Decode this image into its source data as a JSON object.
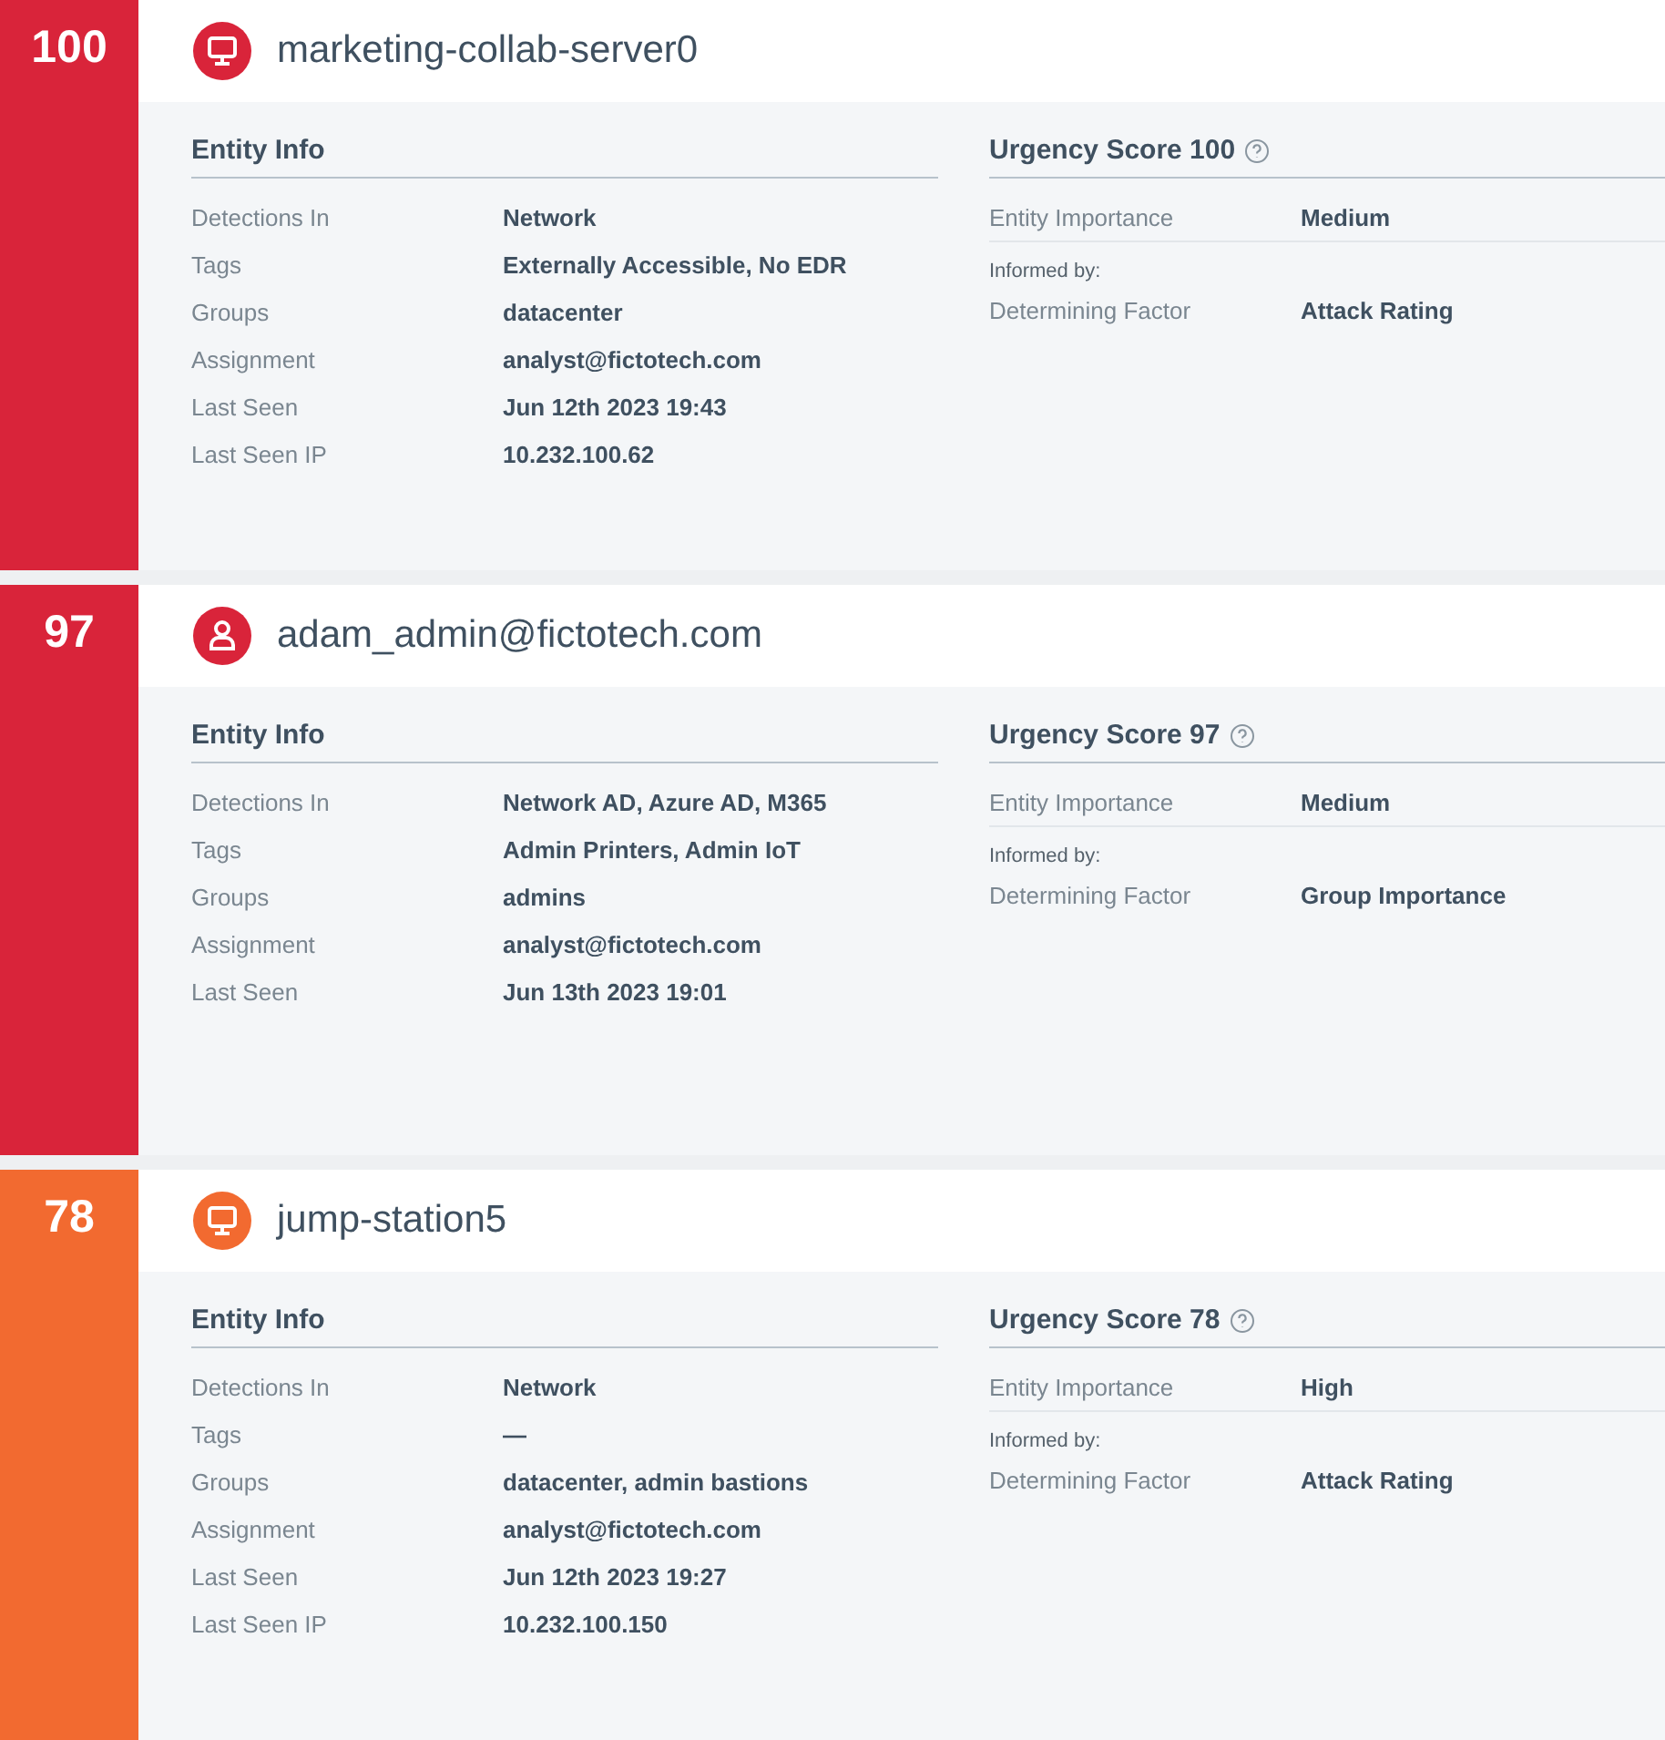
{
  "entities": [
    {
      "score": "100",
      "color": "#d9243a",
      "kind": "host",
      "name": "marketing-collab-server0",
      "info_title": "Entity Info",
      "info": [
        {
          "label": "Detections In",
          "value": "Network"
        },
        {
          "label": "Tags",
          "value": "Externally Accessible, No EDR"
        },
        {
          "label": "Groups",
          "value": "datacenter"
        },
        {
          "label": "Assignment",
          "value": "analyst@fictotech.com"
        },
        {
          "label": "Last Seen",
          "value": "Jun 12th 2023 19:43"
        },
        {
          "label": "Last Seen IP",
          "value": "10.232.100.62"
        }
      ],
      "urgency_title": "Urgency Score 100",
      "importance_label": "Entity Importance",
      "importance": "Medium",
      "informed_by": "Informed by:",
      "factor_label": "Determining Factor",
      "factor": "Attack Rating"
    },
    {
      "score": "97",
      "color": "#d9243a",
      "kind": "account",
      "name": "adam_admin@fictotech.com",
      "info_title": "Entity Info",
      "info": [
        {
          "label": "Detections In",
          "value": "Network AD, Azure AD, M365"
        },
        {
          "label": "Tags",
          "value": "Admin Printers, Admin IoT"
        },
        {
          "label": "Groups",
          "value": "admins"
        },
        {
          "label": "Assignment",
          "value": "analyst@fictotech.com"
        },
        {
          "label": "Last Seen",
          "value": "Jun 13th 2023 19:01"
        }
      ],
      "urgency_title": "Urgency Score 97",
      "importance_label": "Entity Importance",
      "importance": "Medium",
      "informed_by": "Informed by:",
      "factor_label": "Determining Factor",
      "factor": "Group Importance"
    },
    {
      "score": "78",
      "color": "#f26a30",
      "kind": "host",
      "name": "jump-station5",
      "info_title": "Entity Info",
      "info": [
        {
          "label": "Detections In",
          "value": "Network"
        },
        {
          "label": "Tags",
          "value": "—"
        },
        {
          "label": "Groups",
          "value": "datacenter, admin bastions"
        },
        {
          "label": "Assignment",
          "value": "analyst@fictotech.com"
        },
        {
          "label": "Last Seen",
          "value": "Jun 12th 2023 19:27"
        },
        {
          "label": "Last Seen IP",
          "value": "10.232.100.150"
        }
      ],
      "urgency_title": "Urgency Score 78",
      "importance_label": "Entity Importance",
      "importance": "High",
      "informed_by": "Informed by:",
      "factor_label": "Determining Factor",
      "factor": "Attack Rating"
    }
  ]
}
